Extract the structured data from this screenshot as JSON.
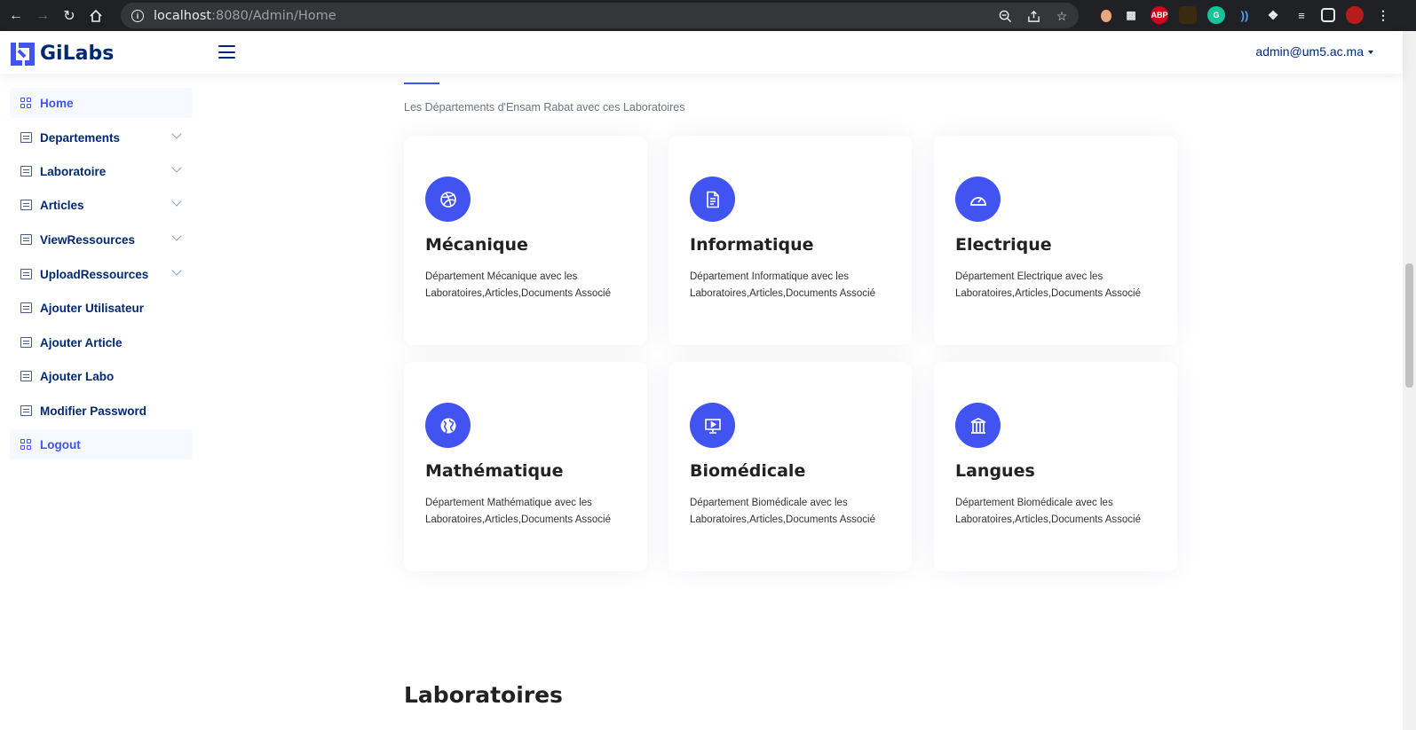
{
  "browser": {
    "url_host": "localhost",
    "url_rest": ":8080/Admin/Home",
    "ext_abp": "ABP"
  },
  "header": {
    "logo_text": "GiLabs",
    "user": "admin@um5.ac.ma"
  },
  "sidebar": {
    "items": [
      {
        "label": "Home"
      },
      {
        "label": "Departements"
      },
      {
        "label": "Laboratoire"
      },
      {
        "label": "Articles"
      },
      {
        "label": "ViewRessources"
      },
      {
        "label": "UploadRessources"
      },
      {
        "label": "Ajouter Utilisateur"
      },
      {
        "label": "Ajouter Article"
      },
      {
        "label": "Ajouter Labo"
      },
      {
        "label": "Modifier Password"
      },
      {
        "label": "Logout"
      }
    ]
  },
  "main": {
    "subtitle": "Les Départements d'Ensam Rabat avec ces Laboratoires",
    "cards": [
      {
        "title": "Mécanique",
        "desc": "Département Mécanique avec les Laboratoires,Articles,Documents Associé",
        "icon": "dribbble-icon"
      },
      {
        "title": "Informatique",
        "desc": "Département Informatique avec les Laboratoires,Articles,Documents Associé",
        "icon": "document-icon"
      },
      {
        "title": "Electrique",
        "desc": "Département Electrique avec les Laboratoires,Articles,Documents Associé",
        "icon": "speedometer-icon"
      },
      {
        "title": "Mathématique",
        "desc": "Département Mathématique avec les Laboratoires,Articles,Documents Associé",
        "icon": "globe-icon"
      },
      {
        "title": "Biomédicale",
        "desc": "Département Biomédicale avec les Laboratoires,Articles,Documents Associé",
        "icon": "easel-icon"
      },
      {
        "title": "Langues",
        "desc": "Département Biomédicale avec les Laboratoires,Articles,Documents Associé",
        "icon": "bank-icon"
      }
    ],
    "section_title": "Laboratoires"
  },
  "colors": {
    "accent": "#4154f1",
    "navy": "#012970"
  }
}
